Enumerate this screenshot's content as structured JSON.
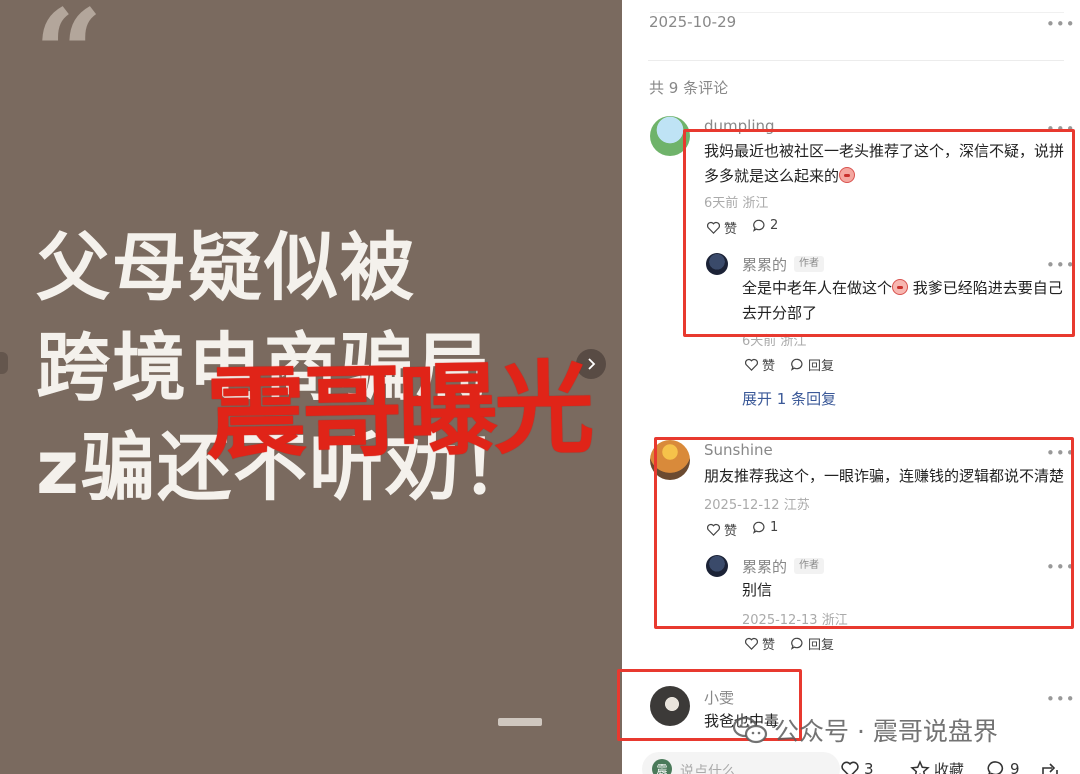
{
  "image_panel": {
    "quote_mark": "“",
    "headline_lines": [
      "父母疑似被",
      "跨境电商骗局",
      "z骗还不听劝！"
    ],
    "stamp_text": "震哥曝光"
  },
  "post": {
    "date": "2025-10-29",
    "comment_count_label": "共 9 条评论"
  },
  "comments": [
    {
      "user": "dumpling",
      "text": "我妈最近也被社区一老头推荐了这个，深信不疑，说拼多多就是这么起来的",
      "time": "6天前",
      "location": "浙江",
      "like_label": "赞",
      "reply_count": "2",
      "replies": [
        {
          "user": "累累的",
          "tag": "作者",
          "text": "全是中老年人在做这个",
          "text_tail": "我爹已经陷进去要自己去开分部了",
          "time": "6天前",
          "location": "浙江",
          "like_label": "赞",
          "reply_label": "回复"
        }
      ],
      "expand_label": "展开 1 条回复"
    },
    {
      "user": "Sunshine",
      "text": "朋友推荐我这个，一眼诈骗，连赚钱的逻辑都说不清楚",
      "time": "2025-12-12",
      "location": "江苏",
      "like_label": "赞",
      "reply_count": "1",
      "replies": [
        {
          "user": "累累的",
          "tag": "作者",
          "text": "别信",
          "time": "2025-12-13",
          "location": "浙江",
          "like_label": "赞",
          "reply_label": "回复"
        }
      ]
    },
    {
      "user": "小雯",
      "text": "我爸也中毒"
    }
  ],
  "bottom_bar": {
    "input_placeholder": "说点什么...",
    "input_avatar_char": "震",
    "like_count": "3",
    "favorite_label": "收藏",
    "comment_count": "9"
  },
  "watermark": {
    "text": "公众号 · 震哥说盘界"
  },
  "icons": {
    "more": "more-dots-icon",
    "like": "heart-icon",
    "comment": "comment-bubble-icon",
    "favorite": "star-icon",
    "share": "share-icon",
    "next": "chevron-right-icon"
  },
  "colors": {
    "image_bg": "#7a6a5f",
    "stamp_red": "#e02418",
    "highlight_box": "#e8392f",
    "link_blue": "#3b5998"
  }
}
